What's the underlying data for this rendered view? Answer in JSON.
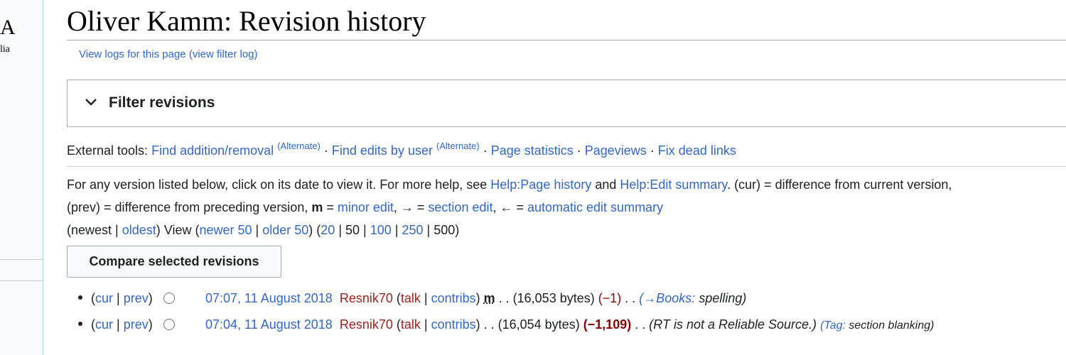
{
  "sidebar": {
    "logo_fragment": "A",
    "logo_sub_fragment": "lia"
  },
  "page": {
    "title": "Oliver Kamm: Revision history",
    "view_logs": "View logs for this page",
    "view_filter_log": "(view filter log)"
  },
  "filter": {
    "title": "Filter revisions"
  },
  "external_tools": {
    "label": "External tools:",
    "sep": " · ",
    "items": [
      {
        "label": "Find addition/removal",
        "sup": "(Alternate)"
      },
      {
        "label": "Find edits by user",
        "sup": "(Alternate)"
      },
      {
        "label": "Page statistics"
      },
      {
        "label": "Pageviews"
      },
      {
        "label": "Fix dead links"
      }
    ]
  },
  "help": {
    "line1_prefix": "For any version listed below, click on its date to view it. For more help, see ",
    "help_page_history": "Help:Page history",
    "and": " and ",
    "help_edit_summary": "Help:Edit summary",
    "line1_suffix": ". (cur) = difference from current version,",
    "line2_prefix": "(prev) = difference from preceding version,  ",
    "m": "m",
    "eq": " = ",
    "minor_edit": "minor edit",
    "arrow_right_eq": ", → = ",
    "section_edit": "section edit",
    "arrow_left_eq": ", ← = ",
    "automatic_edit_summary": "automatic edit summary"
  },
  "nav": {
    "open_paren": "(",
    "newest": "newest",
    "pipe": " | ",
    "oldest": "oldest",
    "view": ") View (",
    "newer": "newer 50",
    "older": "older 50",
    "close_open": ") (",
    "n20": "20",
    "n50": "50",
    "n100": "100",
    "n250": "250",
    "n500": "500",
    "close": ")"
  },
  "compare_button": "Compare selected revisions",
  "revisions": [
    {
      "cur": "cur",
      "prev": "prev",
      "date": "07:07, 11 August 2018",
      "user": "Resnik70",
      "talk": "talk",
      "contribs": "contribs",
      "minor": "m",
      "size": "(16,053 bytes)",
      "diff": "(−1)",
      "comment_arrow": "(→Books:",
      "comment": " spelling)",
      "tag_label": "",
      "tag_value": ""
    },
    {
      "cur": "cur",
      "prev": "prev",
      "date": "07:04, 11 August 2018",
      "user": "Resnik70",
      "talk": "talk",
      "contribs": "contribs",
      "minor": "",
      "size": "(16,054 bytes)",
      "diff": "(−1,109)",
      "comment_arrow": "",
      "comment": "(RT is not a Reliable Source.)",
      "tag_label": "(Tag:",
      "tag_value": " section blanking)"
    }
  ],
  "colors": {
    "link": "#3366cc",
    "redlink": "#a02020",
    "negative": "#8b0000",
    "border": "#a2a9b1"
  }
}
